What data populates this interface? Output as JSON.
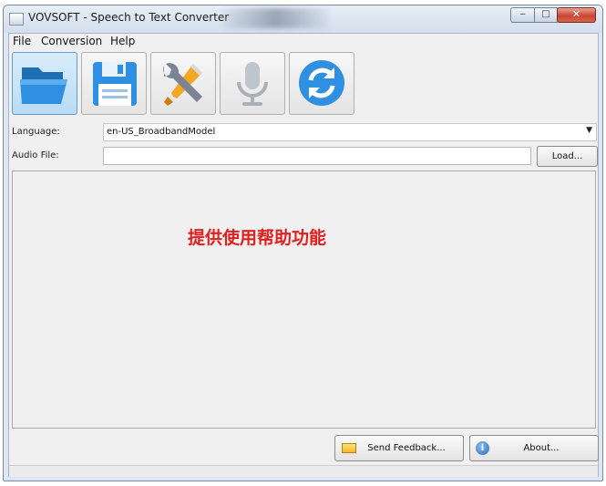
{
  "window": {
    "title": "VOVSOFT - Speech to Text Converter",
    "controls": {
      "minimize": "‒",
      "maximize": "□",
      "close": "✕"
    }
  },
  "menu": [
    "File",
    "Conversion",
    "Help"
  ],
  "toolbar": [
    {
      "icon": "folder-open-icon"
    },
    {
      "icon": "floppy-save-icon"
    },
    {
      "icon": "wrench-screwdriver-icon"
    },
    {
      "icon": "microphone-icon"
    },
    {
      "icon": "refresh-icon"
    }
  ],
  "form": {
    "language_label": "Language:",
    "language_value": "en-US_BroadbandModel",
    "audio_label": "Audio File:",
    "audio_value": "",
    "load_label": "Load..."
  },
  "overlay_text": "提供使用帮助功能",
  "footer": {
    "feedback_label": "Send Feedback...",
    "about_label": "About...",
    "info_glyph": "i"
  },
  "colors": {
    "overlay_text": "#e02020",
    "active_button": "#b9dcf4",
    "close_button": "#c64633"
  }
}
